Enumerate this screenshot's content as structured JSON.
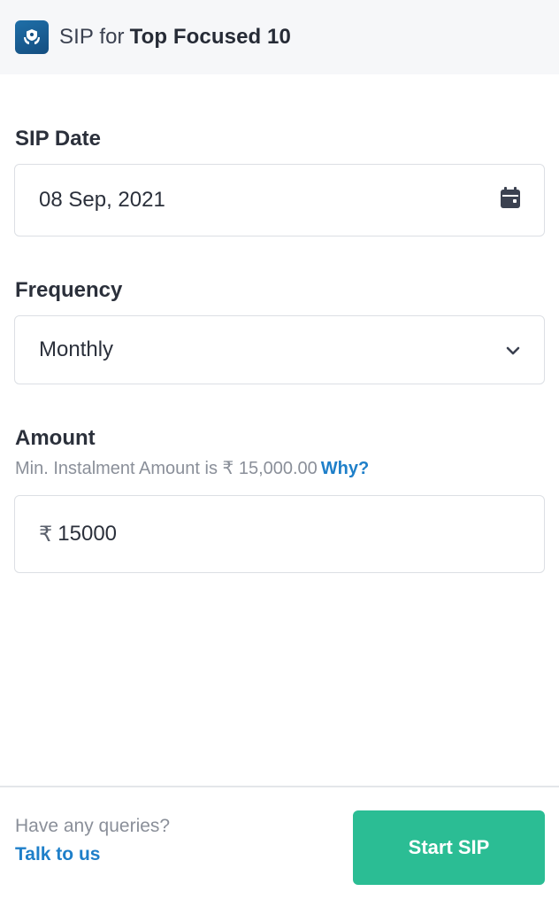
{
  "header": {
    "prefix": "SIP for",
    "fund_name": "Top Focused 10",
    "logo_icon": "shield-hands-logo"
  },
  "form": {
    "sip_date": {
      "label": "SIP Date",
      "value": "08 Sep, 2021",
      "icon": "calendar-icon"
    },
    "frequency": {
      "label": "Frequency",
      "value": "Monthly",
      "icon": "chevron-down-icon"
    },
    "amount": {
      "label": "Amount",
      "hint": "Min. Instalment Amount is ₹ 15,000.00",
      "hint_link": "Why?",
      "currency_symbol": "₹",
      "value": "15000"
    }
  },
  "footer": {
    "query_text": "Have any queries?",
    "talk_link": "Talk to us",
    "start_button": "Start SIP"
  },
  "colors": {
    "accent_green": "#2bbd94",
    "link_blue": "#1e7fc9",
    "header_bg": "#f6f7f9"
  }
}
